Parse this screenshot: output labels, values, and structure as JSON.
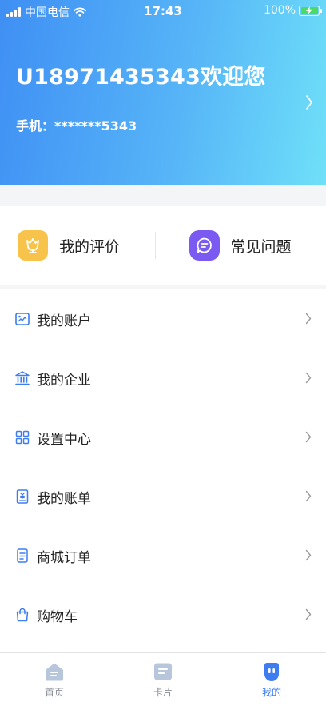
{
  "status_bar": {
    "carrier": "中国电信",
    "time": "17:43",
    "battery": "100%"
  },
  "profile": {
    "welcome": "U18971435343欢迎您",
    "phone": "手机：*******5343"
  },
  "quick_actions": [
    {
      "label": "我的评价",
      "icon": "flower-icon",
      "color": "#f7c34a"
    },
    {
      "label": "常见问题",
      "icon": "chat-bubble-icon",
      "color": "#7a5af0"
    }
  ],
  "menu": [
    {
      "label": "我的账户",
      "icon": "account-card-icon"
    },
    {
      "label": "我的企业",
      "icon": "bank-building-icon"
    },
    {
      "label": "设置中心",
      "icon": "grid-icon"
    },
    {
      "label": "我的账单",
      "icon": "bill-icon"
    },
    {
      "label": "商城订单",
      "icon": "order-list-icon"
    },
    {
      "label": "购物车",
      "icon": "shopping-bag-icon"
    }
  ],
  "tabs": [
    {
      "label": "首页",
      "icon": "home-icon",
      "active": false
    },
    {
      "label": "卡片",
      "icon": "card-icon",
      "active": false
    },
    {
      "label": "我的",
      "icon": "profile-face-icon",
      "active": true
    }
  ],
  "colors": {
    "accent": "#3d7df1",
    "header_start": "#3f8ff4",
    "header_end": "#6fe0f8"
  }
}
